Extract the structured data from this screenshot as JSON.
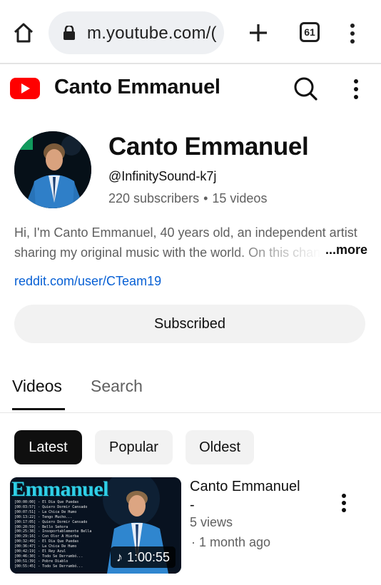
{
  "browser": {
    "url": "m.youtube.com/(",
    "tab_count": "61",
    "icons": [
      "home-icon",
      "lock-icon",
      "plus-icon",
      "tabs-icon",
      "kebab-menu-icon"
    ]
  },
  "header": {
    "title": "Canto Emmanuel",
    "brand_color": "#ff0000"
  },
  "channel": {
    "name": "Canto Emmanuel",
    "handle": "@InfinitySound-k7j",
    "subscribers": "220 subscribers",
    "separator": "•",
    "videos": "15 videos",
    "description_line1": "Hi, I'm Canto Emmanuel, 40 years old, an independent artist",
    "description_line2": "sharing my original music with the world. On this chan",
    "more": "...more",
    "link": "reddit.com/user/CTeam19",
    "subscribe_label": "Subscribed"
  },
  "tabs": {
    "videos": "Videos",
    "search": "Search"
  },
  "chips": {
    "latest": "Latest",
    "popular": "Popular",
    "oldest": "Oldest"
  },
  "video": {
    "thumb_title": "Emmanuel",
    "duration": "1:00:55",
    "title_line1": "Canto Emmanuel",
    "title_line2": "-",
    "views": "5 views",
    "age": "· 1 month ago",
    "tracklist": [
      "[00:00:00] - El Dia Que Puedas",
      "[00:03:57] - Quiero Dormir Cansado",
      "[00:07:51] - La Chica De Humo",
      "[00:13:22] - Tengo Mucho...",
      "[00:17:05] - Quiero Dormir Cansado",
      "[00:20:59] - Bello Señora",
      "[00:25:38] - Insoportablemente Bella",
      "[00:29:16] - Con Olor A Hierba",
      "[00:32:49] - El Dia Que Puedas",
      "[00:36:47] - La Chica De Humo",
      "[00:42:19] - El Rey Azul",
      "[00:46:30] - Todo Se Derrumbó...",
      "[00:51:39] - Pobre Diablo",
      "[00:55:45] - Todo Se Derrumbó..."
    ]
  }
}
